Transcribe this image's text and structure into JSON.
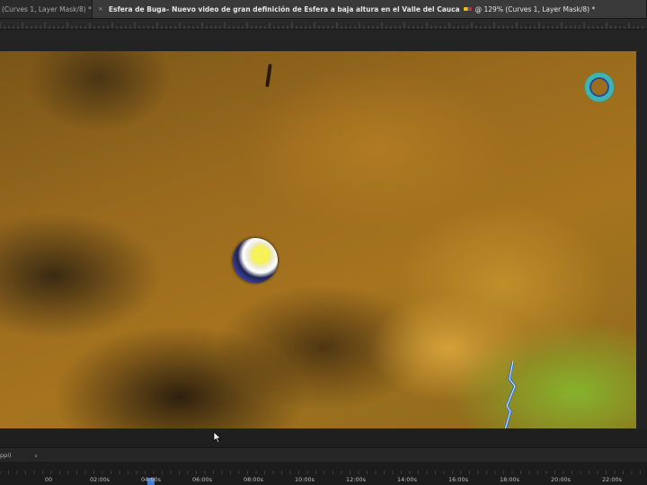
{
  "tabs": [
    {
      "title": "(Curves 1, Layer Mask/8) *",
      "active": false
    },
    {
      "title_part1": "Esfera de Buga– Nuevo video de gran definición de Esfera a baja altura en el Valle del Cauca",
      "title_part2": "@ 129% (Curves 1, Layer Mask/8) *",
      "active": true
    }
  ],
  "tab_close_glyph": "×",
  "status": {
    "info": "ppi)",
    "arrow": "›"
  },
  "timeline": {
    "labels": [
      "00",
      "02:00s",
      "04:00s",
      "06:00s",
      "08:00s",
      "10:00s",
      "12:00s",
      "14:00s",
      "16:00s",
      "18:00s",
      "20:00s",
      "22:00s"
    ],
    "playhead_label_index": 2,
    "playhead_color": "#3f7fd9"
  },
  "icons": {
    "tab_flag": "colombia-flag-icon",
    "cursor": "mouse-pointer-icon"
  },
  "colors": {
    "sky_dark": "#3a2a12",
    "sky_mid": "#a6741f",
    "sky_green": "#86b22b",
    "ring": "#3fb3b5"
  }
}
